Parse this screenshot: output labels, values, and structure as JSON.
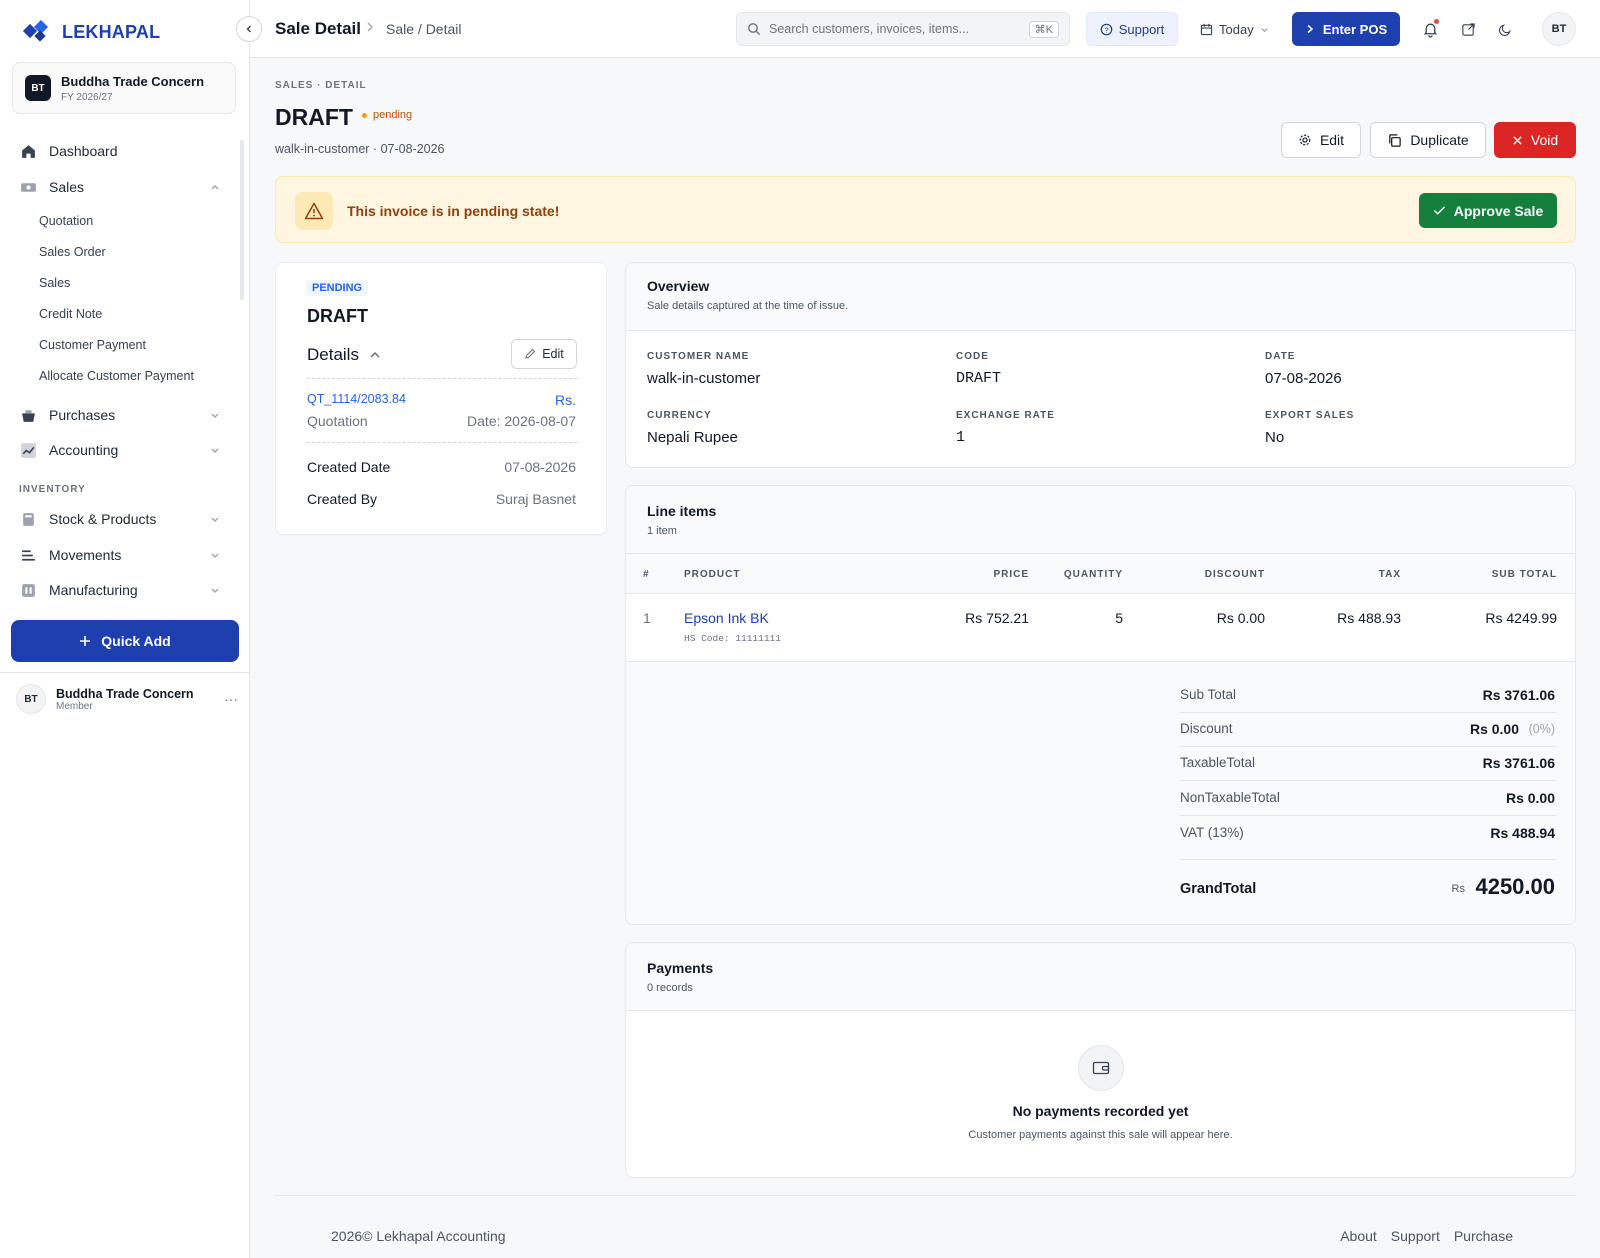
{
  "brand": {
    "name": "LEKHAPAL",
    "color": "#1e40af"
  },
  "org": {
    "initials": "BT",
    "name": "Buddha Trade Concern",
    "fy": "FY 2026/27"
  },
  "sidebar": {
    "main": [
      {
        "label": "Dashboard",
        "icon": "home-icon"
      },
      {
        "label": "Sales",
        "icon": "sales-icon"
      }
    ],
    "sales_sub": [
      "Quotation",
      "Sales Order",
      "Sales",
      "Credit Note",
      "Customer Payment",
      "Allocate Customer Payment"
    ],
    "more": [
      {
        "label": "Purchases",
        "icon": "basket-icon"
      },
      {
        "label": "Accounting",
        "icon": "chart-icon"
      }
    ],
    "section": "INVENTORY",
    "inventory": [
      {
        "label": "Stock & Products",
        "icon": "box-icon"
      },
      {
        "label": "Movements",
        "icon": "move-icon"
      },
      {
        "label": "Manufacturing",
        "icon": "factory-icon"
      }
    ],
    "quick_add": "Quick Add",
    "user": {
      "initials": "BT",
      "name": "Buddha Trade Concern",
      "role": "Member",
      "more": "···"
    }
  },
  "topbar": {
    "title": "Sale Detail",
    "breadcrumb": "Sale / Detail",
    "search_placeholder": "Search customers, invoices, items...",
    "shortcut": "⌘K",
    "support": "Support",
    "today": "Today",
    "pos": "Enter POS",
    "avatar": "BT"
  },
  "header": {
    "eyebrow": "SALES · DETAIL",
    "title": "DRAFT",
    "status": "pending",
    "subtitle": "walk-in-customer · 07-08-2026",
    "edit": "Edit",
    "duplicate": "Duplicate",
    "void": "Void"
  },
  "alert": {
    "text": "This invoice is in pending state!",
    "approve": "Approve Sale"
  },
  "left_card": {
    "badge": "PENDING",
    "title": "DRAFT",
    "details": "Details",
    "edit": "Edit",
    "ref_code": "QT_1114/2083.84",
    "ref_currency": "Rs.",
    "ref_type": "Quotation",
    "ref_date": "Date: 2026-08-07",
    "created_date_label": "Created Date",
    "created_date": "07-08-2026",
    "created_by_label": "Created By",
    "created_by": "Suraj Basnet"
  },
  "overview": {
    "title": "Overview",
    "subtitle": "Sale details captured at the time of issue.",
    "fields": [
      {
        "label": "CUSTOMER NAME",
        "value": "walk-in-customer"
      },
      {
        "label": "CODE",
        "value": "DRAFT"
      },
      {
        "label": "DATE",
        "value": "07-08-2026"
      },
      {
        "label": "CURRENCY",
        "value": "Nepali Rupee"
      },
      {
        "label": "EXCHANGE RATE",
        "value": "1"
      },
      {
        "label": "EXPORT SALES",
        "value": "No"
      }
    ]
  },
  "line_items": {
    "title": "Line items",
    "subtitle": "1 item",
    "columns": [
      "#",
      "PRODUCT",
      "PRICE",
      "QUANTITY",
      "DISCOUNT",
      "TAX",
      "SUB TOTAL"
    ],
    "rows": [
      {
        "n": "1",
        "product": "Epson Ink BK",
        "hs": "HS Code: 11111111",
        "price": "Rs 752.21",
        "qty": "5",
        "discount": "Rs 0.00",
        "tax": "Rs 488.93",
        "subtotal": "Rs 4249.99"
      }
    ],
    "totals": {
      "sub_total_label": "Sub Total",
      "sub_total": "Rs 3761.06",
      "discount_label": "Discount",
      "discount": "Rs 0.00",
      "discount_pct": "(0%)",
      "taxable_label": "TaxableTotal",
      "taxable": "Rs 3761.06",
      "nontaxable_label": "NonTaxableTotal",
      "nontaxable": "Rs 0.00",
      "vat_label": "VAT (13%)",
      "vat": "Rs 488.94",
      "grand_label": "GrandTotal",
      "grand_currency": "Rs",
      "grand": "4250.00"
    }
  },
  "payments": {
    "title": "Payments",
    "subtitle": "0 records",
    "empty_title": "No payments recorded yet",
    "empty_sub": "Customer payments against this sale will appear here."
  },
  "footer": {
    "copyright": "2026© Lekhapal Accounting",
    "links": [
      "About",
      "Support",
      "Purchase"
    ]
  }
}
